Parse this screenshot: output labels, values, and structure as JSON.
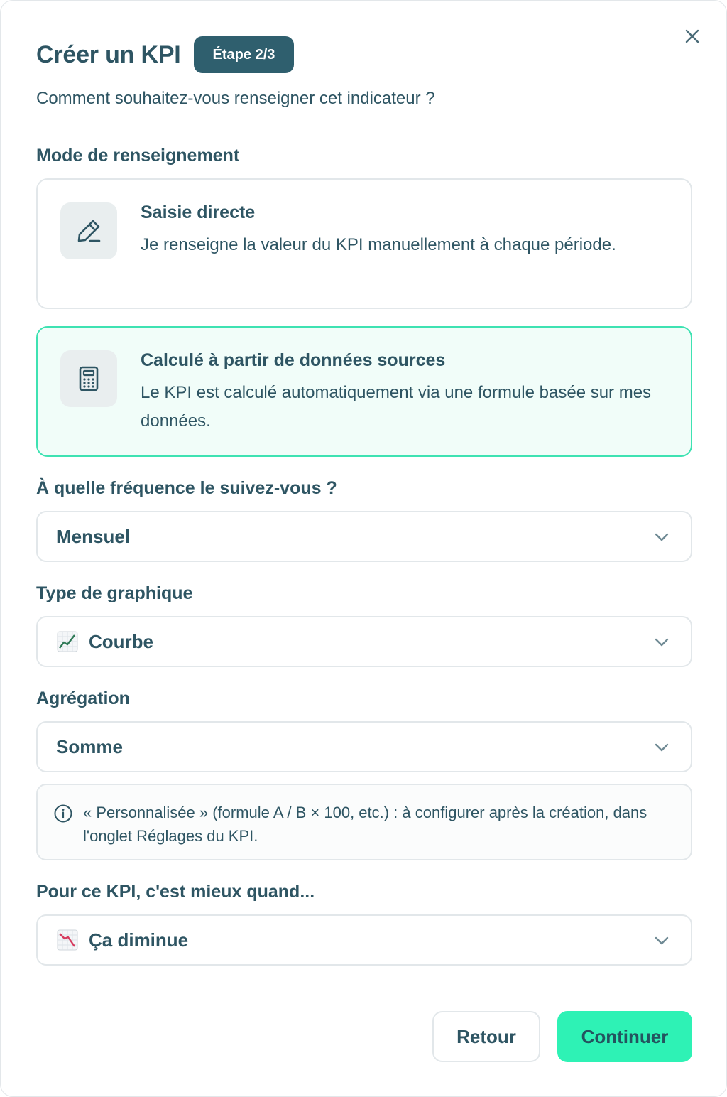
{
  "dialog": {
    "title": "Créer un KPI",
    "step_badge": "Étape 2/3",
    "subtitle": "Comment souhaitez-vous renseigner cet indicateur ?",
    "close_icon": "close-icon"
  },
  "mode": {
    "label": "Mode de renseignement",
    "options": [
      {
        "title": "Saisie directe",
        "description": "Je renseigne la valeur du KPI manuellement à chaque période.",
        "icon": "pencil-icon",
        "selected": false
      },
      {
        "title": "Calculé à partir de données sources",
        "description": "Le KPI est calculé automatiquement via une formule basée sur mes données.",
        "icon": "calculator-icon",
        "selected": true
      }
    ]
  },
  "frequency": {
    "label": "À quelle fréquence le suivez-vous ?",
    "value": "Mensuel"
  },
  "chart_type": {
    "label": "Type de graphique",
    "value": "Courbe",
    "icon": "chart-increasing-emoji"
  },
  "aggregation": {
    "label": "Agrégation",
    "value": "Somme",
    "info_text": "« Personnalisée » (formule A / B × 100, etc.) : à configurer après la création, dans l'onglet Réglages du KPI."
  },
  "direction": {
    "label": "Pour ce KPI, c'est mieux quand...",
    "value": "Ça diminue",
    "icon": "chart-decreasing-emoji"
  },
  "actions": {
    "back_label": "Retour",
    "continue_label": "Continuer"
  },
  "colors": {
    "text": "#2e5563",
    "badge_bg": "#2f5f6e",
    "accent": "#2ef2b5",
    "selected_border": "#3ee2b2",
    "selected_bg": "#f1fdf9"
  }
}
